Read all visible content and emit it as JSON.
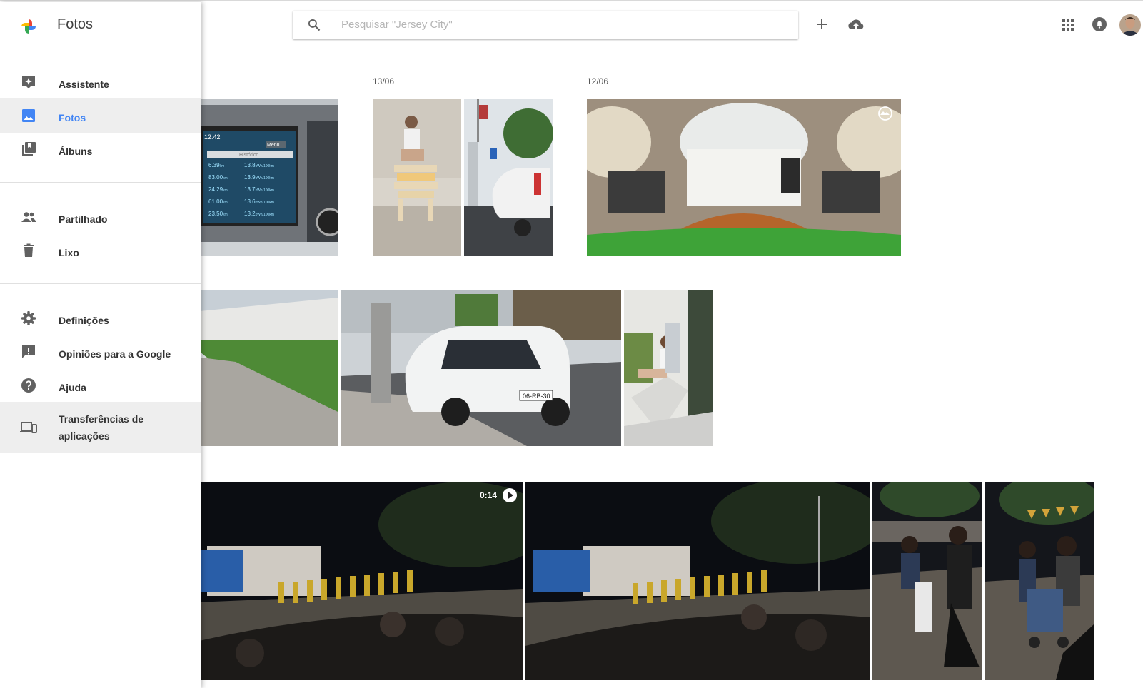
{
  "app": {
    "name": "Fotos"
  },
  "search": {
    "placeholder": "Pesquisar \"Jersey City\""
  },
  "sidebar": {
    "items": [
      {
        "label": "Assistente"
      },
      {
        "label": "Fotos"
      },
      {
        "label": "Álbuns"
      },
      {
        "label": "Partilhado"
      },
      {
        "label": "Lixo"
      },
      {
        "label": "Definições"
      },
      {
        "label": "Opiniões para a Google"
      },
      {
        "label": "Ajuda"
      },
      {
        "label": "Transferências de aplicações"
      }
    ]
  },
  "groups": [
    {
      "date": ""
    },
    {
      "date": "13/06"
    },
    {
      "date": "12/06"
    }
  ],
  "video": {
    "duration": "0:14"
  },
  "dash": {
    "time": "12:42",
    "menu": "Menu",
    "history": "Histórico",
    "rows": [
      {
        "dist": "6.39",
        "cons": "13.8"
      },
      {
        "dist": "83.00",
        "cons": "13.9"
      },
      {
        "dist": "24.29",
        "cons": "13.7"
      },
      {
        "dist": "61.00",
        "cons": "13.6"
      },
      {
        "dist": "23.50",
        "cons": "13.2"
      }
    ],
    "dist_unit": "km",
    "cons_unit": "kWh/100km"
  },
  "plate": "06-RB-30",
  "colors": {
    "accent": "#4285f4",
    "active_bg": "#eeeeee",
    "icon": "#616161"
  }
}
